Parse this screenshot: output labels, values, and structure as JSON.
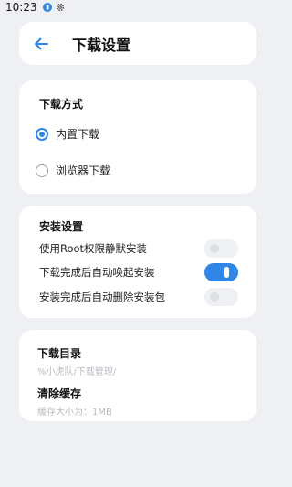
{
  "status_bar": {
    "time": "10:23",
    "icons": [
      "bluetooth-icon",
      "settings-gear-icon"
    ]
  },
  "header": {
    "back_icon": "arrow-left-icon",
    "title": "下载设置"
  },
  "download_method": {
    "title": "下载方式",
    "options": [
      {
        "label": "内置下载",
        "checked": true
      },
      {
        "label": "浏览器下载",
        "checked": false
      }
    ]
  },
  "install_settings": {
    "title": "安装设置",
    "toggles": [
      {
        "label": "使用Root权限静默安装",
        "on": false
      },
      {
        "label": "下载完成后自动唤起安装",
        "on": true
      },
      {
        "label": "安装完成后自动删除安装包",
        "on": false
      }
    ]
  },
  "misc": {
    "download_dir": {
      "title": "下载目录",
      "value": "%小虎队/下载管理/"
    },
    "clear_cache": {
      "title": "清除缓存",
      "value": "缓存大小为：1MB"
    }
  },
  "colors": {
    "accent": "#2f86e6",
    "background": "#eff0f3",
    "card": "#ffffff"
  }
}
